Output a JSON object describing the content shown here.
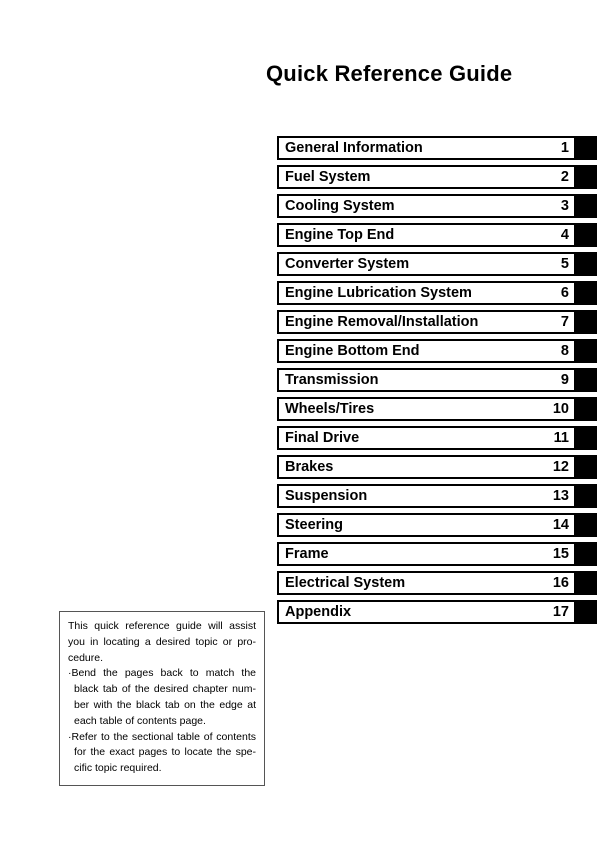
{
  "page": {
    "title": "Quick Reference Guide"
  },
  "chapter_index": {
    "rows": [
      {
        "label": "General Information",
        "number": "1"
      },
      {
        "label": "Fuel System",
        "number": "2"
      },
      {
        "label": "Cooling System",
        "number": "3"
      },
      {
        "label": "Engine Top End",
        "number": "4"
      },
      {
        "label": "Converter System",
        "number": "5"
      },
      {
        "label": "Engine Lubrication System",
        "number": "6"
      },
      {
        "label": "Engine Removal/Installation",
        "number": "7"
      },
      {
        "label": "Engine Bottom End",
        "number": "8"
      },
      {
        "label": "Transmission",
        "number": "9"
      },
      {
        "label": "Wheels/Tires",
        "number": "10"
      },
      {
        "label": "Final Drive",
        "number": "11"
      },
      {
        "label": "Brakes",
        "number": "12"
      },
      {
        "label": "Suspension",
        "number": "13"
      },
      {
        "label": "Steering",
        "number": "14"
      },
      {
        "label": "Frame",
        "number": "15"
      },
      {
        "label": "Electrical System",
        "number": "16"
      },
      {
        "label": "Appendix",
        "number": "17"
      }
    ]
  },
  "note": {
    "intro": "This quick reference guide will assist you in locating a desired topic or pro-cedure.",
    "bullet_1": "·Bend the pages back to match the black tab of the desired chapter num-ber with the black tab on the edge at each table of contents page.",
    "bullet_2": "·Refer to the sectional table of contents for the exact pages to locate the spe-cific topic required."
  }
}
